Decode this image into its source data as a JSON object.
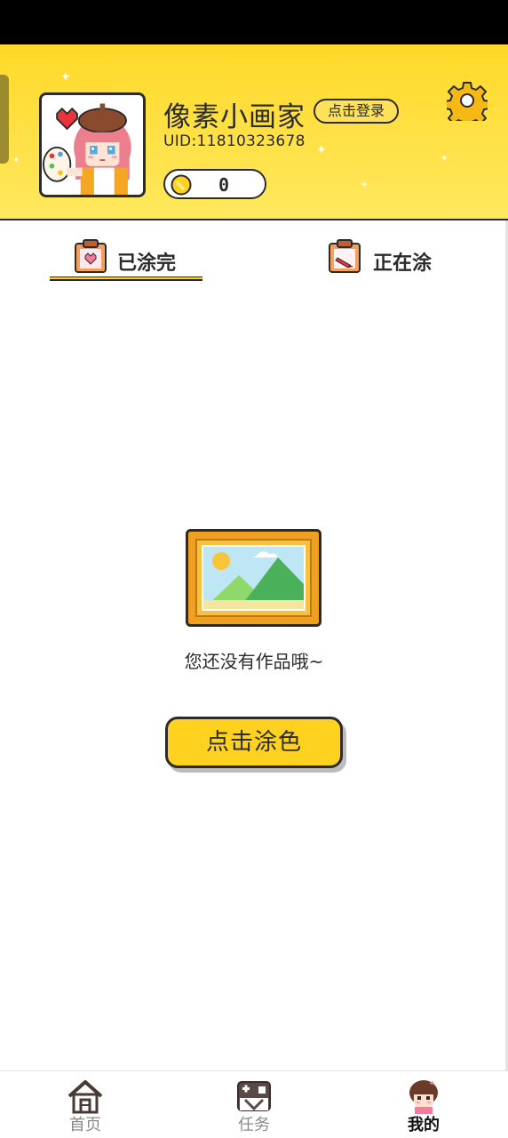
{
  "profile": {
    "name": "像素小画家",
    "login_label": "点击登录",
    "uid": "UID:11810323678",
    "coins": "0"
  },
  "tabs": [
    {
      "label": "已涂完",
      "active": true
    },
    {
      "label": "正在涂",
      "active": false
    }
  ],
  "empty_state": {
    "message": "您还没有作品哦~",
    "button_label": "点击涂色"
  },
  "bottom_nav": [
    {
      "label": "首页",
      "icon": "house-icon",
      "active": false
    },
    {
      "label": "任务",
      "icon": "task-icon",
      "active": false
    },
    {
      "label": "我的",
      "icon": "profile-avatar-icon",
      "active": true
    }
  ],
  "colors": {
    "header_yellow": "#ffd928",
    "accent_yellow": "#ffd21f",
    "outline": "#2b2b2b",
    "frame_orange": "#f0a020"
  }
}
